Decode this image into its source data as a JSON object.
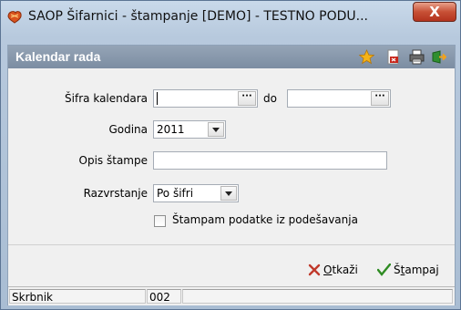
{
  "window": {
    "title": "SAOP  Šifarnici - štampanje [DEMO] - TESTNO PODU...",
    "close_label": "X"
  },
  "panel": {
    "title": "Kalendar rada",
    "toolbar_icons": [
      "star-icon",
      "pdf-icon",
      "printer-icon",
      "exit-icon"
    ]
  },
  "form": {
    "sifra_label": "Šifra kalendara",
    "sifra_from_value": "",
    "do_label": "do",
    "sifra_to_value": "",
    "lookup_label": "···",
    "godina_label": "Godina",
    "godina_value": "2011",
    "opis_label": "Opis štampe",
    "opis_value": "",
    "razvrstanje_label": "Razvrstanje",
    "razvrstanje_value": "Po šifri",
    "checkbox_label": "Štampam podatke iz podešavanja",
    "checkbox_checked": false
  },
  "actions": {
    "cancel_prefix": "",
    "cancel_mnemonic": "O",
    "cancel_rest": "tkaži",
    "print_prefix": "Š",
    "print_mnemonic": "t",
    "print_rest": "ampaj"
  },
  "status": {
    "user_label": "Skrbnik",
    "user_code": "002"
  },
  "colors": {
    "header_bar": "#8596aa",
    "cancel_icon": "#c0392b",
    "print_icon": "#2e8b22"
  }
}
